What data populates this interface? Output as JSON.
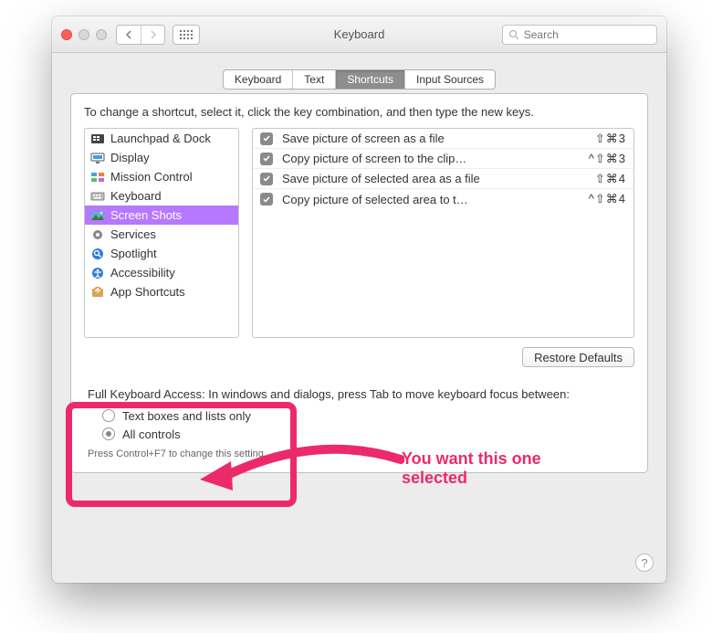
{
  "window": {
    "title": "Keyboard",
    "search_placeholder": "Search"
  },
  "tabs": [
    "Keyboard",
    "Text",
    "Shortcuts",
    "Input Sources"
  ],
  "selected_tab_index": 2,
  "intro": "To change a shortcut, select it, click the key combination, and then type the new keys.",
  "categories": [
    {
      "label": "Launchpad & Dock",
      "icon": "launchpad"
    },
    {
      "label": "Display",
      "icon": "display"
    },
    {
      "label": "Mission Control",
      "icon": "mission-control"
    },
    {
      "label": "Keyboard",
      "icon": "keyboard"
    },
    {
      "label": "Screen Shots",
      "icon": "screenshots",
      "selected": true
    },
    {
      "label": "Services",
      "icon": "services"
    },
    {
      "label": "Spotlight",
      "icon": "spotlight"
    },
    {
      "label": "Accessibility",
      "icon": "accessibility"
    },
    {
      "label": "App Shortcuts",
      "icon": "app-shortcuts"
    }
  ],
  "shortcuts": [
    {
      "enabled": true,
      "desc": "Save picture of screen as a file",
      "keys": "⇧⌘3"
    },
    {
      "enabled": true,
      "desc": "Copy picture of screen to the clip…",
      "keys": "^⇧⌘3"
    },
    {
      "enabled": true,
      "desc": "Save picture of selected area as a file",
      "keys": "⇧⌘4"
    },
    {
      "enabled": true,
      "desc": "Copy picture of selected area to t…",
      "keys": "^⇧⌘4"
    }
  ],
  "restore_label": "Restore Defaults",
  "fka": {
    "header": "Full Keyboard Access: In windows and dialogs, press Tab to move keyboard focus between:",
    "options": [
      "Text boxes and lists only",
      "All controls"
    ],
    "selected_index": 1,
    "hint": "Press Control+F7 to change this setting."
  },
  "annotation": {
    "text_line1": "You want this one",
    "text_line2": "selected"
  }
}
